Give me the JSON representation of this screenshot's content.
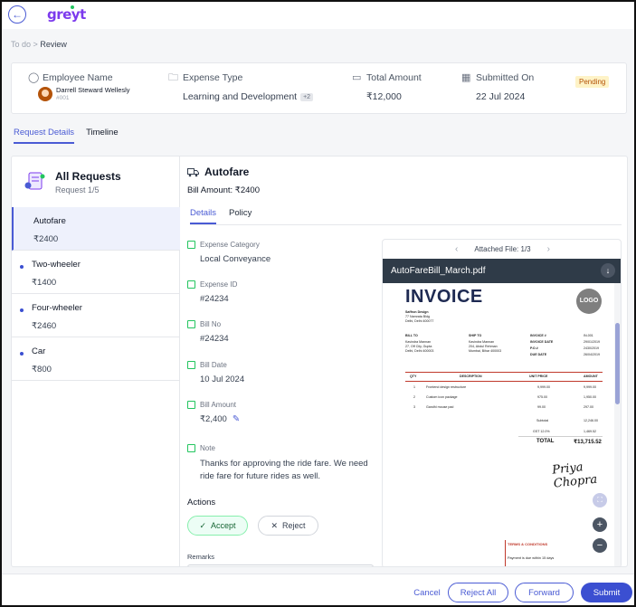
{
  "app": {
    "logo": "greyt",
    "back_icon": "arrow-left-icon"
  },
  "breadcrumb": {
    "parent": "To do",
    "separator": ">",
    "current": "Review"
  },
  "summary": {
    "employee_label": "Employee Name",
    "employee_name": "Darrell Steward Wellesly",
    "employee_id": "#001",
    "expense_type_label": "Expense Type",
    "expense_type_value": "Learning and Development",
    "expense_type_more": "+2",
    "total_label": "Total Amount",
    "total_value": "₹12,000",
    "submitted_label": "Submitted On",
    "submitted_value": "22 Jul 2024",
    "status": "Pending",
    "status_color": "#b45309"
  },
  "tabs": [
    {
      "label": "Request Details",
      "active": true
    },
    {
      "label": "Timeline",
      "active": false
    }
  ],
  "requests": {
    "title": "All Requests",
    "subtitle": "Request 1/5",
    "items": [
      {
        "name": "Autofare",
        "amount": "₹2400",
        "active": true
      },
      {
        "name": "Two-wheeler",
        "amount": "₹1400",
        "active": false
      },
      {
        "name": "Four-wheeler",
        "amount": "₹2460",
        "active": false
      },
      {
        "name": "Car",
        "amount": "₹800",
        "active": false
      }
    ]
  },
  "detail": {
    "title": "Autofare",
    "title_icon": "truck-icon",
    "bill_amount": "Bill Amount: ₹2400",
    "subtabs": [
      {
        "label": "Details",
        "active": true
      },
      {
        "label": "Policy",
        "active": false
      }
    ],
    "fields": {
      "category_label": "Expense Category",
      "category_value": "Local Conveyance",
      "expense_id_label": "Expense ID",
      "expense_id_value": "#24234",
      "bill_no_label": "Bill No",
      "bill_no_value": "#24234",
      "bill_date_label": "Bill Date",
      "bill_date_value": "10 Jul 2024",
      "bill_amount_label": "Bill Amount",
      "bill_amount_value": "₹2,400",
      "note_label": "Note",
      "note_value": "Thanks for approving the ride fare. We need ride fare for future rides as well."
    },
    "actions_label": "Actions",
    "accept_label": "Accept",
    "reject_label": "Reject",
    "remarks_label": "Remarks"
  },
  "viewer": {
    "attached": "Attached File: 1/3",
    "file_name": "AutoFareBill_March.pdf",
    "invoice": {
      "title": "INVOICE",
      "logo": "LOGO",
      "company": "Saffron Design",
      "company_addr1": "77 Namrata Bldg",
      "company_addr2": "Delhi, Delhi 400077",
      "bill_to": "BILL TO",
      "bill_to_1": "Kavindra Mannan",
      "bill_to_2": "27, Off City, Gupta",
      "bill_to_3": "Delhi, Delhi 400003",
      "ship_to": "SHIP TO",
      "ship_to_1": "Kavindra Mannan",
      "ship_to_2": "204, Abdul Rehman",
      "ship_to_3": "Mumbai, Bihar 400003",
      "meta_labels": [
        "INVOICE #",
        "INVOICE DATE",
        "P.O.#",
        "DUE DATE"
      ],
      "meta_values": [
        "IN-001",
        "29/01/2019",
        "2430/2019",
        "26/04/2019"
      ],
      "col_qty": "QTY",
      "col_desc": "DESCRIPTION",
      "col_price": "UNIT PRICE",
      "col_amount": "AMOUNT",
      "rows": [
        {
          "qty": "1",
          "desc": "Frontend design restructure",
          "price": "9,999.00",
          "amount": "9,999.00"
        },
        {
          "qty": "2",
          "desc": "Custom icon package",
          "price": "975.00",
          "amount": "1,950.00"
        },
        {
          "qty": "3",
          "desc": "Gandhi mouse pad",
          "price": "99.00",
          "amount": "297.00"
        }
      ],
      "subtotal_label": "Subtotal",
      "subtotal_value": "12,246.00",
      "gst_label": "GST 12.0%",
      "gst_value": "1,469.52",
      "total_label": "TOTAL",
      "total_value": "₹13,715.52",
      "terms_title": "TERMS & CONDITIONS",
      "terms_text": "Payment is due within 15 days"
    }
  },
  "footer": {
    "cancel": "Cancel",
    "reject_all": "Reject All",
    "forward": "Forward",
    "submit": "Submit"
  }
}
